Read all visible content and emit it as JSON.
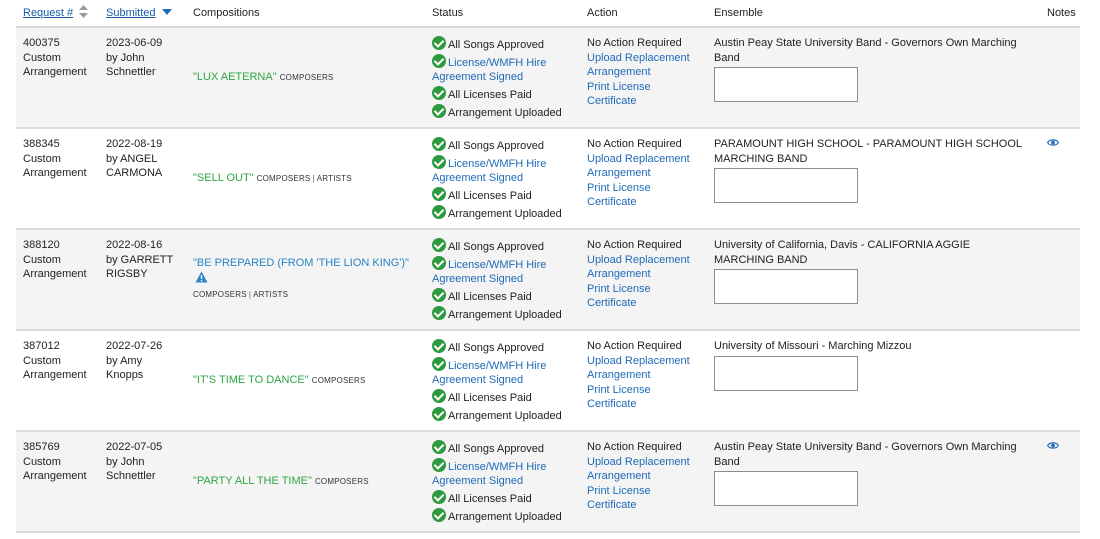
{
  "header": {
    "request": "Request #",
    "submitted": "Submitted",
    "compositions": "Compositions",
    "status": "Status",
    "action": "Action",
    "ensemble": "Ensemble",
    "notes": "Notes"
  },
  "rows": [
    {
      "id": "400375",
      "type": "Custom Arrangement",
      "date": "2023-06-09",
      "by": "by John Schnettler",
      "song": "\"LUX AETERNA\"",
      "credits": [
        "COMPOSERS"
      ],
      "warning": false,
      "status": {
        "approved": "All Songs Approved",
        "license": "License/WMFH Hire Agreement Signed",
        "paid": "All Licenses Paid",
        "uploaded": "Arrangement Uploaded"
      },
      "action": {
        "none": "No Action Required",
        "upload": "Upload Replacement Arrangement",
        "print": "Print License Certificate"
      },
      "ensemble": "Austin Peay State University Band - Governors Own Marching Band",
      "has_notes": false
    },
    {
      "id": "388345",
      "type": "Custom Arrangement",
      "date": "2022-08-19",
      "by": "by ANGEL CARMONA",
      "song": "\"SELL OUT\"",
      "credits": [
        "COMPOSERS",
        "ARTISTS"
      ],
      "warning": false,
      "status": {
        "approved": "All Songs Approved",
        "license": "License/WMFH Hire Agreement Signed",
        "paid": "All Licenses Paid",
        "uploaded": "Arrangement Uploaded"
      },
      "action": {
        "none": "No Action Required",
        "upload": "Upload Replacement Arrangement",
        "print": "Print License Certificate"
      },
      "ensemble": "PARAMOUNT HIGH SCHOOL - PARAMOUNT HIGH SCHOOL MARCHING BAND",
      "has_notes": true
    },
    {
      "id": "388120",
      "type": "Custom Arrangement",
      "date": "2022-08-16",
      "by": "by GARRETT RIGSBY",
      "song": "\"BE PREPARED (FROM 'THE LION KING')\"",
      "credits": [
        "COMPOSERS",
        "ARTISTS"
      ],
      "warning": true,
      "status": {
        "approved": "All Songs Approved",
        "license": "License/WMFH Hire Agreement Signed",
        "paid": "All Licenses Paid",
        "uploaded": "Arrangement Uploaded"
      },
      "action": {
        "none": "No Action Required",
        "upload": "Upload Replacement Arrangement",
        "print": "Print License Certificate"
      },
      "ensemble": "University of California, Davis - CALIFORNIA AGGIE MARCHING BAND",
      "has_notes": false
    },
    {
      "id": "387012",
      "type": "Custom Arrangement",
      "date": "2022-07-26",
      "by": "by Amy Knopps",
      "song": "\"IT'S TIME TO DANCE\"",
      "credits": [
        "COMPOSERS"
      ],
      "warning": false,
      "status": {
        "approved": "All Songs Approved",
        "license": "License/WMFH Hire Agreement Signed",
        "paid": "All Licenses Paid",
        "uploaded": "Arrangement Uploaded"
      },
      "action": {
        "none": "No Action Required",
        "upload": "Upload Replacement Arrangement",
        "print": "Print License Certificate"
      },
      "ensemble": "University of Missouri - Marching Mizzou",
      "has_notes": false
    },
    {
      "id": "385769",
      "type": "Custom Arrangement",
      "date": "2022-07-05",
      "by": "by John Schnettler",
      "song": "\"PARTY ALL THE TIME\"",
      "credits": [
        "COMPOSERS"
      ],
      "warning": false,
      "status": {
        "approved": "All Songs Approved",
        "license": "License/WMFH Hire Agreement Signed",
        "paid": "All Licenses Paid",
        "uploaded": "Arrangement Uploaded"
      },
      "action": {
        "none": "No Action Required",
        "upload": "Upload Replacement Arrangement",
        "print": "Print License Certificate"
      },
      "ensemble": "Austin Peay State University Band - Governors Own Marching Band",
      "has_notes": true
    }
  ],
  "colors": {
    "link": "#1f6ab8",
    "song": "#2ea644",
    "song_alt": "#2a83c5",
    "check": "#2e9a3f",
    "row_alt": "#f4f4f4"
  },
  "icons": {
    "sort_request": "sort-both-icon",
    "sort_submitted": "sort-desc-icon",
    "check": "check-circle-icon",
    "notes": "eye-icon",
    "warning": "warning-icon"
  }
}
